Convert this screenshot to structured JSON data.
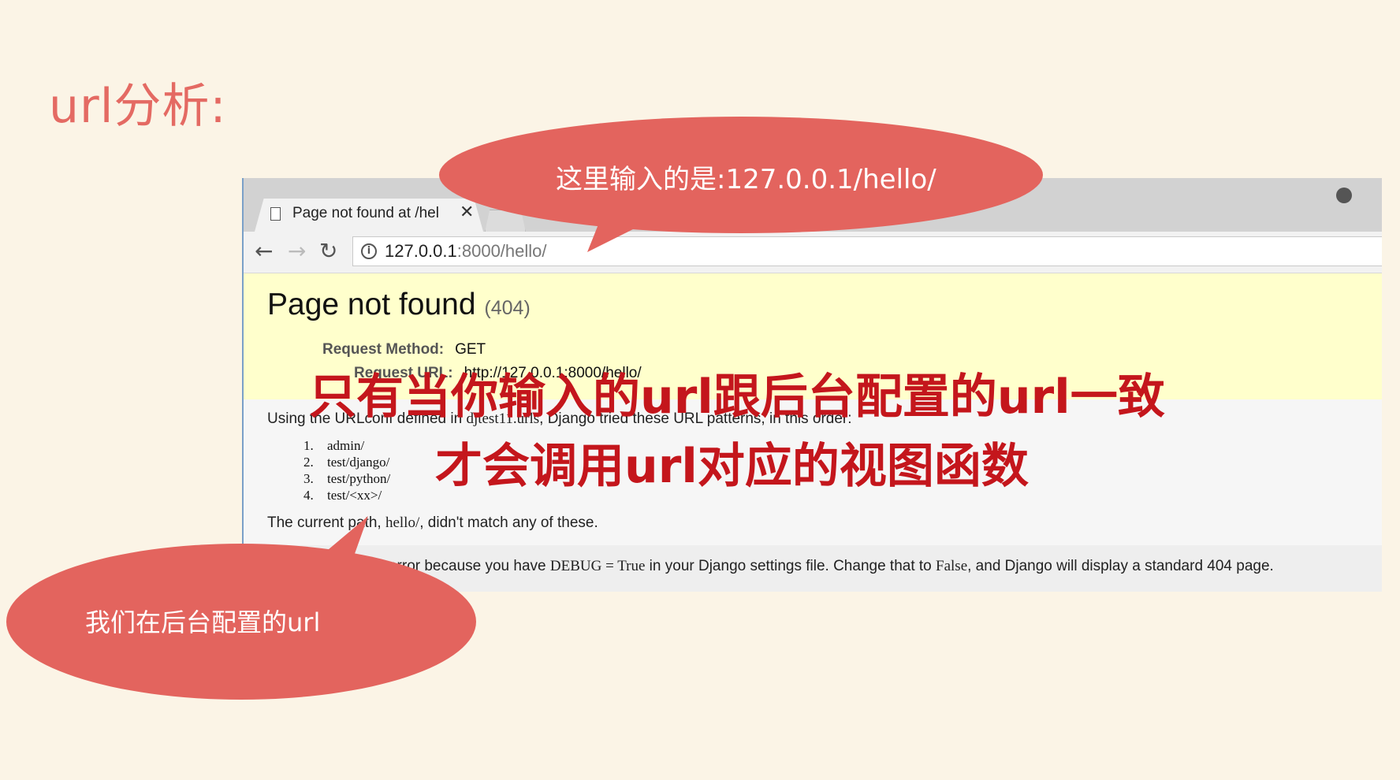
{
  "slide": {
    "title": "url分析:"
  },
  "browser": {
    "tab_title": "Page not found at /hel",
    "tab_close": "✕",
    "address": {
      "host": "127.0.0.1",
      "path": ":8000/hello/"
    },
    "nav": {
      "back": "←",
      "forward": "→",
      "reload": "↻",
      "info": "i"
    }
  },
  "page": {
    "title": "Page not found",
    "status_code": "(404)",
    "request_method_label": "Request Method:",
    "request_method": "GET",
    "request_url_label": "Request URL:",
    "request_url": "http://127.0.0.1:8000/hello/",
    "urlconf_intro_before": "Using the URLconf defined in ",
    "urlconf_module": "djtest11.urls",
    "urlconf_intro_after": ", Django tried these URL patterns, in this order:",
    "patterns": [
      {
        "num": "1.",
        "pattern": "admin/"
      },
      {
        "num": "2.",
        "pattern": "test/django/"
      },
      {
        "num": "3.",
        "pattern": "test/python/"
      },
      {
        "num": "4.",
        "pattern": "test/<xx>/"
      }
    ],
    "current_path_before": "The current path, ",
    "current_path": "hello/",
    "current_path_after": ", didn't match any of these.",
    "explanation_before": "You're seeing this error because you have ",
    "explanation_debug": "DEBUG = True",
    "explanation_middle": " in your Django settings file. Change that to ",
    "explanation_false": "False",
    "explanation_after": ", and Django will display a standard 404 page."
  },
  "annotations": {
    "top_bubble": "这里输入的是:127.0.0.1/hello/",
    "bottom_bubble": "我们在后台配置的url",
    "overlay_line1": "只有当你输入的url跟后台配置的url一致",
    "overlay_line2": "才会调用url对应的视图函数"
  },
  "colors": {
    "background": "#fbf4e6",
    "accent": "#e3645e",
    "overlay_red": "#c4161c",
    "summary_yellow": "#ffffcc"
  }
}
